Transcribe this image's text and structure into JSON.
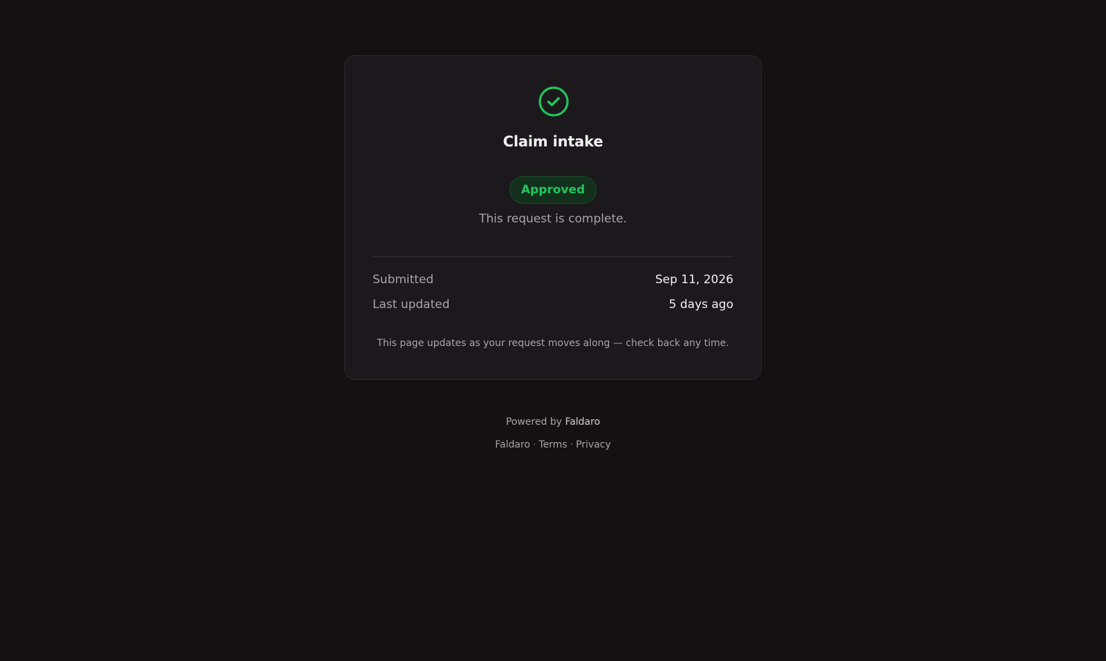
{
  "card": {
    "icon": "check-circle-icon",
    "title": "Claim intake",
    "status_badge": "Approved",
    "status_message": "This request is complete.",
    "details": [
      {
        "label": "Submitted",
        "value": "Sep 11, 2026"
      },
      {
        "label": "Last updated",
        "value": "5 days ago"
      }
    ],
    "note": "This page updates as your request moves along — check back any time."
  },
  "footer": {
    "powered_prefix": "Powered by",
    "powered_brand": "Faldaro",
    "links": [
      "Faldaro",
      "Terms",
      "Privacy"
    ],
    "separator": "·"
  },
  "colors": {
    "background": "#141113",
    "card": "#1c191c",
    "success": "#22c55e",
    "muted_text": "#a9a4a7"
  }
}
